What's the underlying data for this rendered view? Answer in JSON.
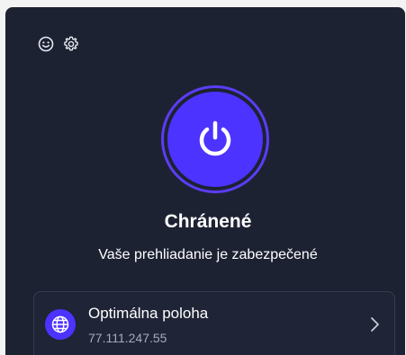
{
  "header": {
    "icons": [
      "smiley-icon",
      "gear-icon"
    ]
  },
  "status": {
    "title": "Chránené",
    "subtitle": "Vaše prehliadanie je zabezpečené",
    "power_icon": "power-icon",
    "accent_color": "#4d33ff"
  },
  "location": {
    "name": "Optimálna poloha",
    "ip": "77.111.247.55",
    "icon": "globe-icon",
    "chevron_icon": "chevron-right-icon"
  }
}
